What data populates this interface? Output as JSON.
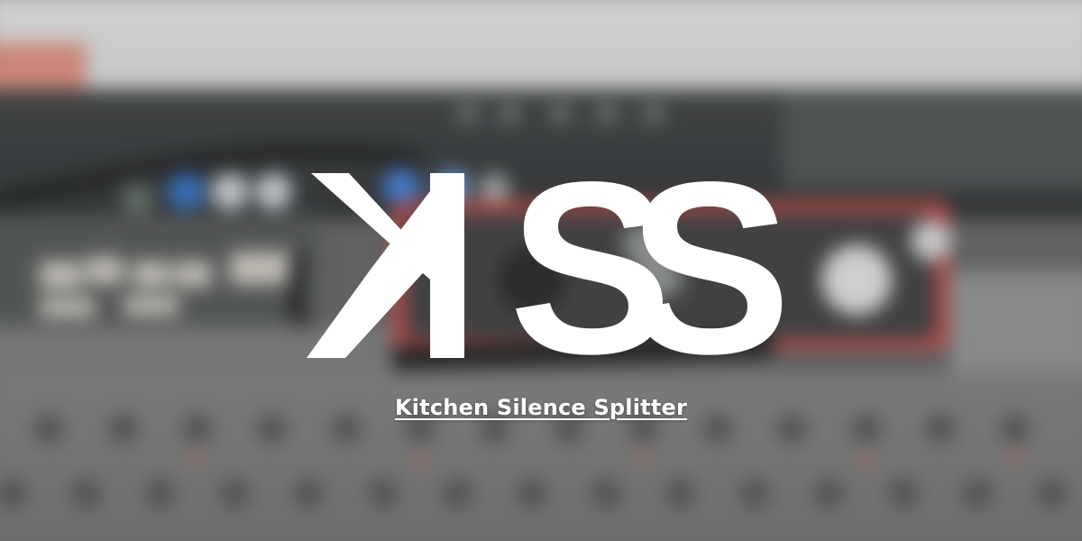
{
  "logo": {
    "letter_1": "K",
    "letter_2": "S",
    "letter_3": "S",
    "color": "#ffffff"
  },
  "subtitle": {
    "text": "Kitchen Silence Splitter",
    "color": "#ffffff"
  },
  "background": {
    "description_icon": "blurred-audio-gear-icon",
    "accent": "#c64a44"
  }
}
